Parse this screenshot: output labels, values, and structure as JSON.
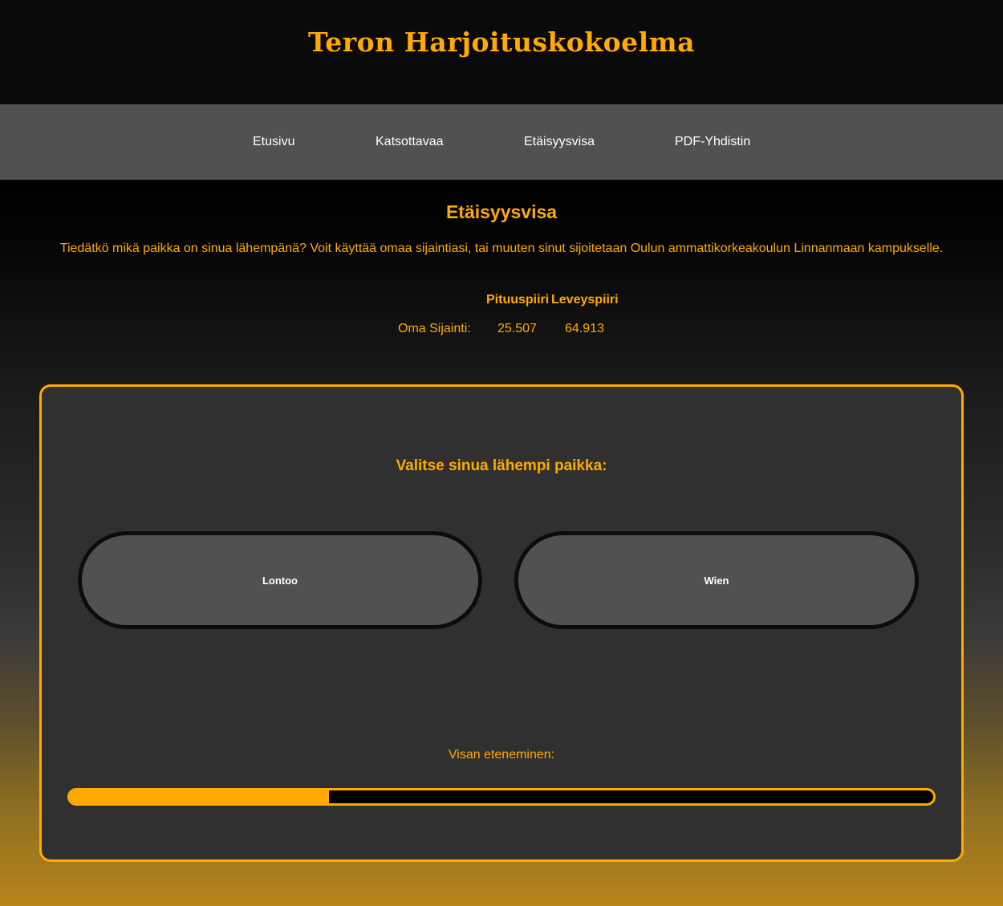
{
  "header": {
    "site_title": "Teron Harjoituskokoelma"
  },
  "nav": {
    "items": [
      {
        "label": "Etusivu"
      },
      {
        "label": "Katsottavaa"
      },
      {
        "label": "Etäisyysvisa"
      },
      {
        "label": "PDF-Yhdistin"
      }
    ]
  },
  "main": {
    "heading": "Etäisyysvisa",
    "intro": "Tiedätkö mikä paikka on sinua lähempänä? Voit käyttää omaa sijaintiasi, tai muuten sinut sijoitetaan Oulun ammattikorkeakoulun Linnanmaan kampukselle.",
    "location_table": {
      "headers": [
        "Pituuspiiri",
        "Leveyspiiri"
      ],
      "row_label": "Oma Sijainti:",
      "longitude": "25.507",
      "latitude": "64.913"
    }
  },
  "quiz": {
    "question": "Valitse sinua lähempi paikka:",
    "choices": [
      {
        "label": "Lontoo"
      },
      {
        "label": "Wien"
      }
    ],
    "progress_label": "Visan eteneminen:",
    "progress_fraction": 0.3
  },
  "colors": {
    "accent": "#ffaa00",
    "nav_background": "#515151",
    "panel_background": "#303030",
    "button_background": "#515151"
  }
}
